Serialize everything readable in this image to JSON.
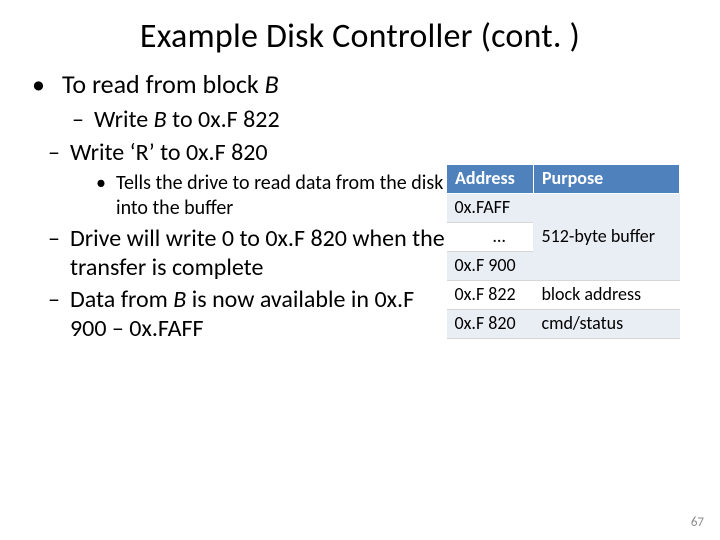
{
  "title": "Example Disk Controller (cont. )",
  "lvl1": {
    "bullet": "•",
    "pre": "To read from block ",
    "ital": "B"
  },
  "lvl2a": {
    "dash": "–",
    "pre": "Write ",
    "ital": "B",
    "post": " to 0x.F 822"
  },
  "lvl2b": {
    "dash": "–",
    "text": "Write ‘R’ to 0x.F 820"
  },
  "lvl3a": {
    "dot": "•",
    "text": "Tells the drive to read data from the disk into the buffer"
  },
  "lvl2c": {
    "dash": "–",
    "text": "Drive will write 0 to 0x.F 820 when the transfer is complete"
  },
  "lvl2d": {
    "dash": "–",
    "pre": "Data from ",
    "ital": "B",
    "post": " is now available in 0x.F 900 – 0x.FAFF"
  },
  "table": {
    "headers": {
      "c1": "Address",
      "c2": "Purpose"
    },
    "r1c1": "0x.FAFF",
    "r2c1": "…",
    "r3c1": "0x.F 900",
    "buffer_purpose": "512-byte buffer",
    "r4": {
      "c1": "0x.F 822",
      "c2": "block address"
    },
    "r5": {
      "c1": "0x.F 820",
      "c2": "cmd/status"
    }
  },
  "page_number": "67"
}
